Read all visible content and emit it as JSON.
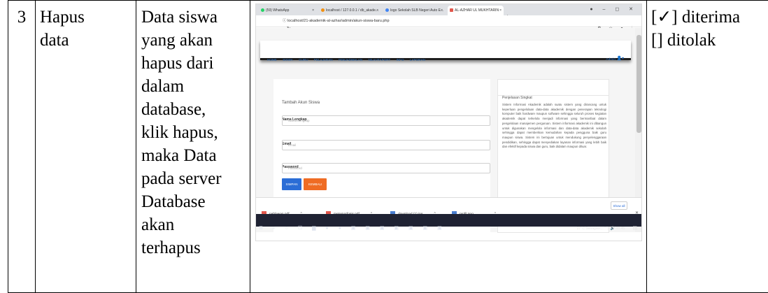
{
  "row": {
    "number": "3",
    "activity": "Hapus\ndata",
    "description": "Data siswa\nyang akan\nhapus dari\ndalam\ndatabase,\nklik hapus,\nmaka Data\npada server\nDatabase\nakan\nterhapus",
    "result_accepted": "[✓] diterima",
    "result_rejected": "[] ditolak"
  },
  "screenshot": {
    "tabs": [
      {
        "label": "(59) WhatsApp",
        "color": "#25d366"
      },
      {
        "label": "localhost / 127.0.0.1 / db_akade...",
        "color": "#f29111"
      },
      {
        "label": "logo Sekolah SLB Negeri Auto E...",
        "color": "#4285f4"
      },
      {
        "label": "AL-AZHAR UL MUKHTARIN",
        "color": "#e2574c"
      }
    ],
    "new_tab": "+",
    "url": "localhost/21-akademik-al-azhar/admin/akun-siswa-baru.php",
    "nav_menu": [
      "HOME",
      "SISWA",
      "GURU",
      "PELAJARAN",
      "PENJADWALAN",
      "NILAI RAPORT",
      "INFO",
      "LAPORAN"
    ],
    "admin_label": "Admin",
    "form": {
      "title": "Tambah Akun Siswa",
      "name_label": "Nama Lengkap",
      "name_placeholder": "Nama Lengkap",
      "email_label": "Email",
      "email_placeholder": "Email",
      "password_label": "Password",
      "password_placeholder": "Password",
      "save_button": "SIMPAN",
      "back_button": "KEMBALI"
    },
    "sidebar": {
      "title": "Penjelasan Singkat",
      "text": "Sistem Informasi Akademik adalah suatu sistem yang dirancang untuk keperluan pengelolaan data-data akademik dengan penerapan teknologi komputer baik hardware maupun software sehingga seluruh proses kegiatan akademik dapat terkelola menjadi informasi yang bermanfaat dalam pengelolaan manajemen perguruan. Sistem informasi akademik ini dibangun untuk digunakan mengelola informasi dan data-data akademik sekolah sehingga dapat memberikan kemudahan kepada pengguna baik guru maupun siswa. Sistem ini bertujuan untuk mendukung penyelenggaraan pendidikan, sehingga dapat menyediakan layanan informasi yang lebih baik dan efektif kepada siswa dan guru, baik didalam maupun diluar."
    },
    "downloads": [
      {
        "name": "pahlawan.pdf",
        "icon": "pdf-icon",
        "color": "#e2574c"
      },
      {
        "name": "metamorfosis.pdf",
        "icon": "pdf-icon",
        "color": "#e2574c"
      },
      {
        "name": "download (1).jpg",
        "icon": "image-icon",
        "color": "#4a7fd0"
      },
      {
        "name": "profil.png",
        "icon": "image-icon",
        "color": "#4a7fd0"
      }
    ],
    "show_all": "Show all",
    "taskbar_status": "27°C Sebagian...  ^  ♫ 🔊  08:45"
  }
}
